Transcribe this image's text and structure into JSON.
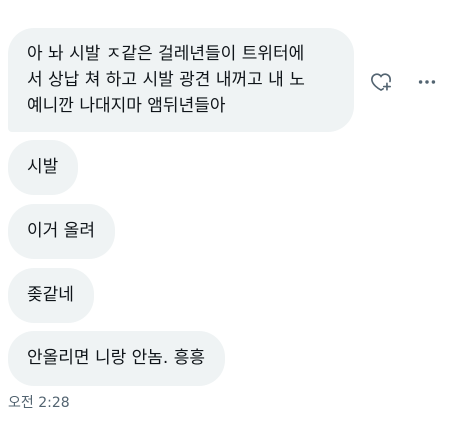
{
  "messages": [
    {
      "lines": [
        "아 놔 시발 ㅈ같은 걸레년들이 트위터에",
        "서 상납 쳐 하고 시발 광견 내꺼고 내 노",
        "예니깐 나대지마 앰뒤년들아"
      ]
    },
    {
      "lines": [
        "시발"
      ]
    },
    {
      "lines": [
        "이거 올려"
      ]
    },
    {
      "lines": [
        "좆같네"
      ]
    },
    {
      "lines": [
        "안올리면 니랑 안놈. 흥흥"
      ]
    }
  ],
  "actions": {
    "react_icon": "heart-plus-icon",
    "more_icon": "more-horizontal-icon"
  },
  "timestamp": "오전 2:28",
  "colors": {
    "bubble": "#eff3f4",
    "text": "#0f1419",
    "muted": "#536471"
  }
}
